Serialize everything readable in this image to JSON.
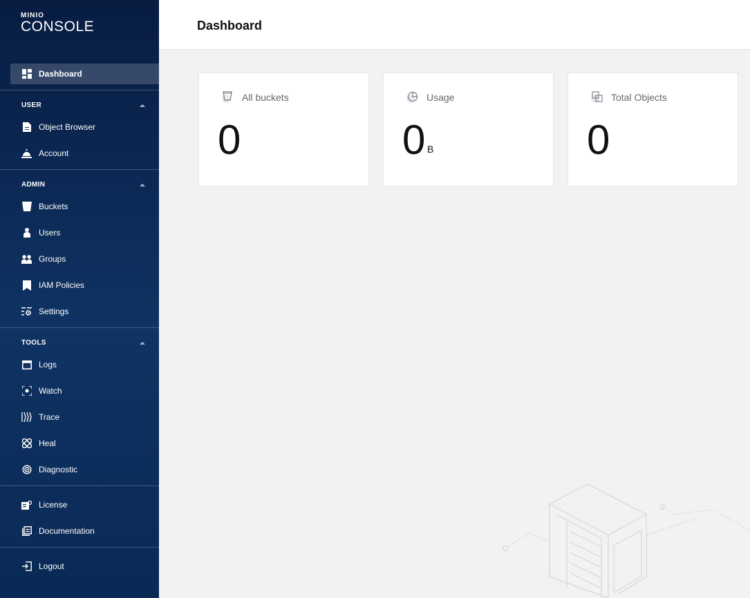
{
  "logo": {
    "brand": "MINIO",
    "product": "CONSOLE"
  },
  "nav": {
    "dashboard": "Dashboard",
    "sections": [
      {
        "title": "USER",
        "items": [
          "Object Browser",
          "Account"
        ]
      },
      {
        "title": "ADMIN",
        "items": [
          "Buckets",
          "Users",
          "Groups",
          "IAM Policies",
          "Settings"
        ]
      },
      {
        "title": "TOOLS",
        "items": [
          "Logs",
          "Watch",
          "Trace",
          "Heal",
          "Diagnostic"
        ]
      }
    ],
    "footer_items": [
      "License",
      "Documentation"
    ],
    "logout": "Logout"
  },
  "header": {
    "title": "Dashboard"
  },
  "cards": [
    {
      "label": "All buckets",
      "value": "0",
      "unit": "",
      "icon": "bucket-icon"
    },
    {
      "label": "Usage",
      "value": "0",
      "unit": "B",
      "icon": "pie-chart-icon"
    },
    {
      "label": "Total Objects",
      "value": "0",
      "unit": "",
      "icon": "objects-icon"
    }
  ]
}
